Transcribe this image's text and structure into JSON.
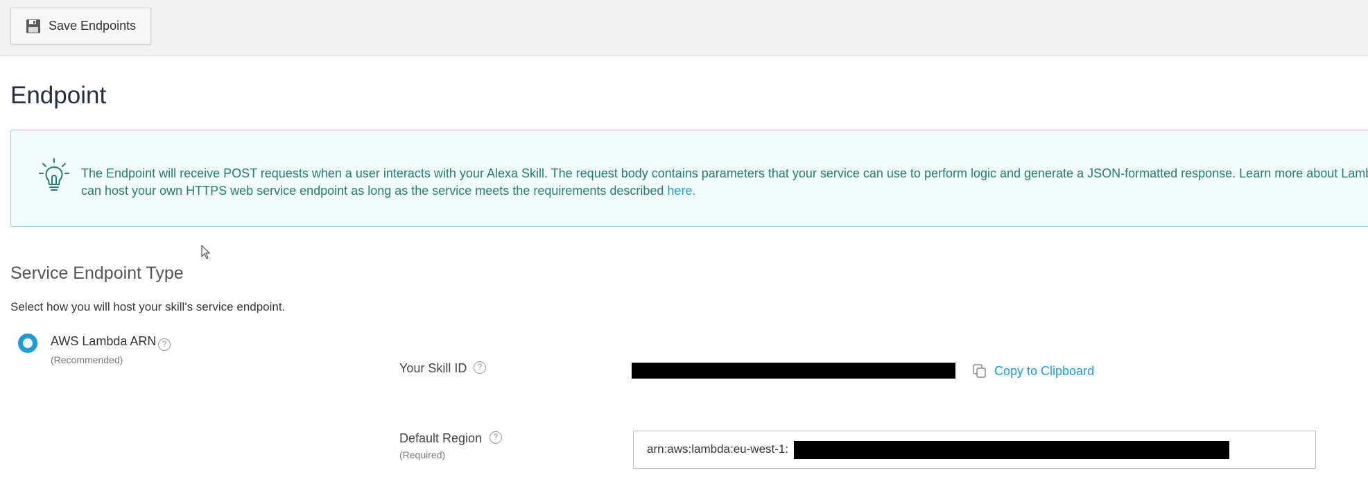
{
  "toolbar": {
    "save_label": "Save Endpoints",
    "save_icon": "floppy-disk-icon"
  },
  "page": {
    "title": "Endpoint"
  },
  "info": {
    "icon": "lightbulb-icon",
    "line1": "The Endpoint will receive POST requests when a user interacts with your Alexa Skill. The request body contains parameters that your service can use to perform logic and generate a JSON-formatted response. Learn more about Lambda endpoin",
    "line2_prefix": "can host your own HTTPS web service endpoint as long as the service meets the requirements described ",
    "line2_link": "here."
  },
  "service": {
    "title": "Service Endpoint Type",
    "description": "Select how you will host your skill's service endpoint.",
    "option": {
      "label": "AWS Lambda ARN",
      "sublabel": "(Recommended)",
      "selected": true
    }
  },
  "skill_id": {
    "label": "Your Skill ID",
    "help": "?",
    "copy_label": "Copy to Clipboard",
    "copy_icon": "copy-icon"
  },
  "default_region": {
    "label": "Default Region",
    "help": "?",
    "sublabel": "(Required)",
    "value_prefix": "arn:aws:lambda:eu-west-1:"
  },
  "colors": {
    "accent": "#1a9ed9",
    "info_bg": "#f1fbf9",
    "info_border": "#8fd3c4",
    "info_text": "#1f7f75"
  }
}
